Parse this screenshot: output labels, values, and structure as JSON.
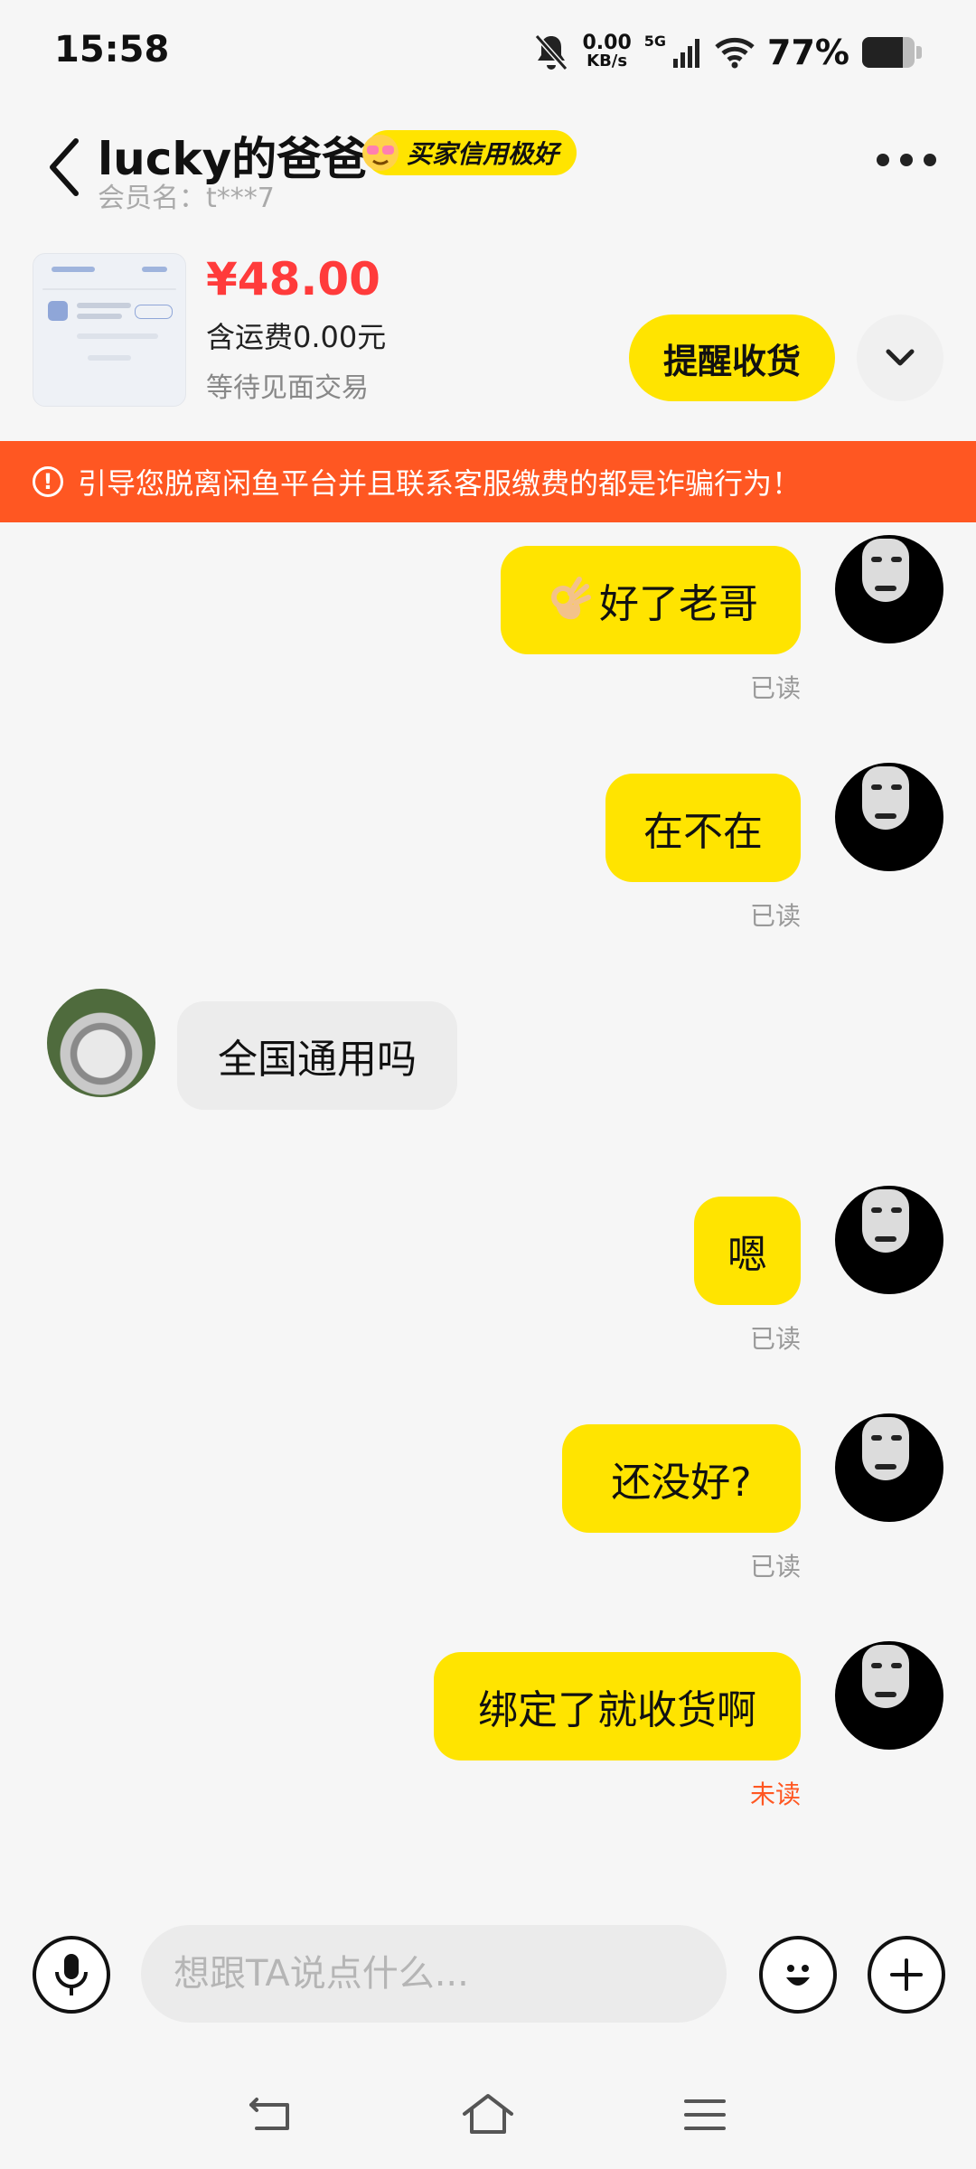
{
  "status_bar": {
    "time": "15:58",
    "net_speed_value": "0.00",
    "net_speed_unit": "KB/s",
    "network": "5G",
    "battery_percent": "77%",
    "battery_level": 0.77
  },
  "header": {
    "title": "lucky的爸爸",
    "credit_badge": "买家信用极好",
    "member_id": "会员名：t***7"
  },
  "product": {
    "price": "¥48.00",
    "shipping": "含运费0.00元",
    "status": "等待见面交易",
    "remind_button": "提醒收货"
  },
  "warning": {
    "text": "引导您脱离闲鱼平台并且联系客服缴费的都是诈骗行为！"
  },
  "messages": [
    {
      "sender": "me",
      "text": "好了老哥",
      "emoji": "ok-hand-icon",
      "status": "已读"
    },
    {
      "sender": "me",
      "text": "在不在",
      "status": "已读"
    },
    {
      "sender": "other",
      "text": "全国通用吗"
    },
    {
      "sender": "me",
      "text": "嗯",
      "status": "已读"
    },
    {
      "sender": "me",
      "text": "还没好?",
      "status": "已读"
    },
    {
      "sender": "me",
      "text": "绑定了就收货啊",
      "status": "未读"
    }
  ],
  "input": {
    "placeholder": "想跟TA说点什么..."
  },
  "colors": {
    "accent_yellow": "#ffe400",
    "price_red": "#ff3b3b",
    "warning_orange": "#ff5722",
    "unread_orange": "#ff5722"
  }
}
